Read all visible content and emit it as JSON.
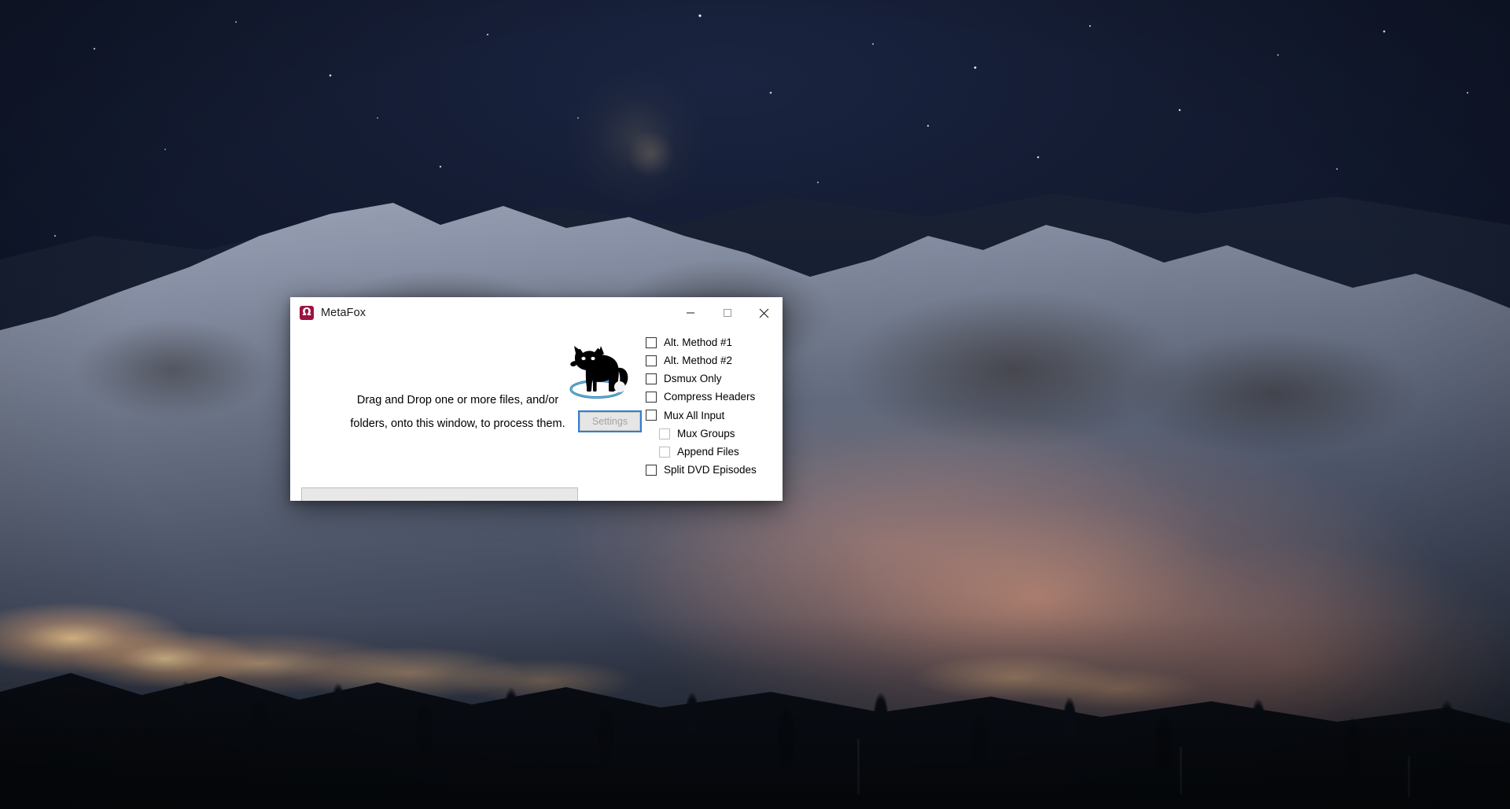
{
  "desktop": {
    "wallpaper_description": "Alpine ski resort at night with snow-covered mountains, starry navy sky and warm orange village lights",
    "colors": {
      "sky": "#141c33",
      "snow_highlight": "#c6ccd8",
      "alpenglow": "#d67638",
      "village_light": "#ffc45c",
      "forest": "#0e131c"
    }
  },
  "window": {
    "title": "MetaFox",
    "icon": "omega-app-icon",
    "icon_glyph": "Ω",
    "icon_color": "#9c1440",
    "controls": {
      "minimize": "minimize-icon",
      "maximize": "maximize-icon",
      "close": "close-icon"
    },
    "client": {
      "drop_hint_line1": "Drag and Drop one or more files, and/or",
      "drop_hint_line2": "folders, onto this window, to process them.",
      "logo": "wolf-logo",
      "settings_label": "Settings",
      "settings_enabled": false,
      "settings_focused": true,
      "progress": {
        "value": 0,
        "max": 100,
        "accent": "#06b025"
      },
      "options": [
        {
          "label": "Alt. Method #1",
          "checked": false,
          "indent": false,
          "disabled": false
        },
        {
          "label": "Alt. Method #2",
          "checked": false,
          "indent": false,
          "disabled": false
        },
        {
          "label": "Dsmux Only",
          "checked": false,
          "indent": false,
          "disabled": false
        },
        {
          "label": "Compress Headers",
          "checked": false,
          "indent": false,
          "disabled": false
        },
        {
          "label": "Mux All Input",
          "checked": false,
          "indent": false,
          "disabled": false
        },
        {
          "label": "Mux Groups",
          "checked": false,
          "indent": true,
          "disabled": true
        },
        {
          "label": "Append Files",
          "checked": false,
          "indent": true,
          "disabled": true
        },
        {
          "label": "Split DVD Episodes",
          "checked": false,
          "indent": false,
          "disabled": false
        }
      ]
    }
  }
}
